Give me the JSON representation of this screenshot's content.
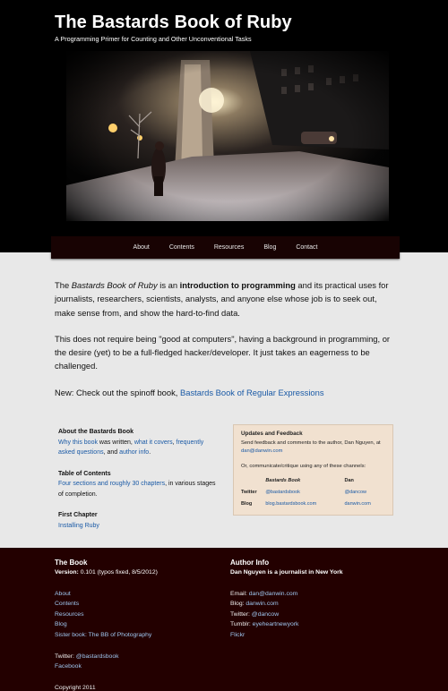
{
  "header": {
    "title": "The Bastards Book of Ruby",
    "tagline": "A Programming Primer for Counting and Other Unconventional Tasks"
  },
  "nav": [
    "About",
    "Contents",
    "Resources",
    "Blog",
    "Contact"
  ],
  "intro": {
    "p1_pre": "The ",
    "p1_book": "Bastards Book of Ruby",
    "p1_mid": " is an ",
    "p1_strong": "introduction to programming",
    "p1_post": " and its practical uses for journalists, researchers, scientists, analysts, and anyone else whose job is to seek out, make sense from, and show the hard-to-find data.",
    "p2": "This does not require being \"good at computers\", having a background in programming, or the desire (yet) to be a full-fledged hacker/developer. It just takes an eagerness to be challenged.",
    "p3_pre": "New: Check out the spinoff book, ",
    "p3_link": "Bastards Book of Regular Expressions"
  },
  "about": {
    "heading": "About the Bastards Book",
    "link1": "Why this book",
    "text1": " was written, ",
    "link2": "what it covers",
    "text2": ", ",
    "link3": "frequently asked questions",
    "text3": ", and ",
    "link4": "author info",
    "text4": "."
  },
  "toc": {
    "heading": "Table of Contents",
    "link": "Four sections and roughly 30 chapters",
    "text": ", in various stages of completion."
  },
  "first_chapter": {
    "heading": "First Chapter",
    "link": "Installing Ruby"
  },
  "updates": {
    "heading": "Updates and Feedback",
    "text": "Send feedback and comments to the author, Dan Nguyen, at",
    "email": "dan@danwin.com",
    "channels": "Or, communicate/critique using any of these channels:",
    "col1": "Bastards Book",
    "col2": "Dan",
    "rows": [
      {
        "label": "Twitter",
        "book": "@bastardsbook",
        "dan": "@dancow"
      },
      {
        "label": "Blog",
        "book": "blog.bastardsbook.com",
        "dan": "danwin.com"
      }
    ]
  },
  "footer": {
    "book_heading": "The Book",
    "version_label": "Version:",
    "version": " 0.101 (typos fixed, 8/5/2012)",
    "links": [
      "About",
      "Contents",
      "Resources",
      "Blog",
      "Sister book: The BB of Photography"
    ],
    "twitter_label": "Twitter: ",
    "twitter": "@bastardsbook",
    "facebook": "Facebook",
    "copyright": "Copyright 2011",
    "author_heading": "Author Info",
    "author_sub": "Dan Nguyen is a journalist in New York",
    "email_label": "Email: ",
    "email": "dan@danwin.com",
    "blog_label": "Blog: ",
    "blog": "danwin.com",
    "tw_label": "Twitter: ",
    "tw": "@dancow",
    "tumblr_label": "Tumblr: ",
    "tumblr": "eyeheartnewyork",
    "flickr": "Flickr"
  }
}
